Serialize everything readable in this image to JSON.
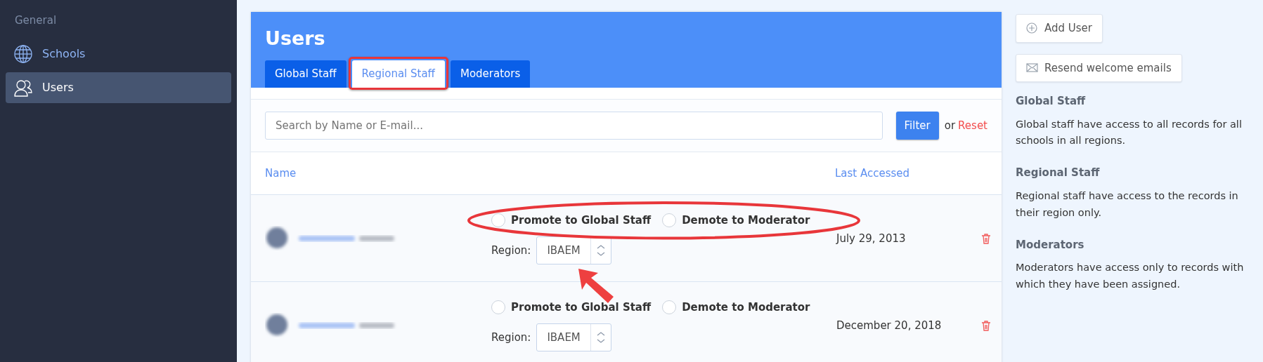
{
  "sidebar": {
    "heading": "General",
    "items": [
      {
        "label": "Schools",
        "selected": false
      },
      {
        "label": "Users",
        "selected": true
      }
    ]
  },
  "panel": {
    "title": "Users",
    "tabs": [
      {
        "label": "Global Staff",
        "selected": false
      },
      {
        "label": "Regional Staff",
        "selected": true
      },
      {
        "label": "Moderators",
        "selected": false
      }
    ],
    "search": {
      "placeholder": "Search by Name or E-mail..."
    },
    "filter_button": "Filter",
    "or_text": "or",
    "reset_link": "Reset",
    "columns": [
      "Name",
      "Last Accessed"
    ],
    "rows": [
      {
        "options": [
          {
            "label": "Promote to Global Staff",
            "selected": false
          },
          {
            "label": "Demote to Moderator",
            "selected": false
          }
        ],
        "region_label": "Region:",
        "region": "IBAEM",
        "last_accessed": "July 29, 2013"
      },
      {
        "options": [
          {
            "label": "Promote to Global Staff",
            "selected": false
          },
          {
            "label": "Demote to Moderator",
            "selected": false
          }
        ],
        "region_label": "Region:",
        "region": "IBAEM",
        "last_accessed": "December 20, 2018"
      }
    ]
  },
  "actions": [
    {
      "label": "Add User"
    },
    {
      "label": "Resend welcome emails"
    }
  ],
  "help": [
    {
      "title": "Global Staff",
      "text": "Global staff have access to all records for all schools in all regions."
    },
    {
      "title": "Regional Staff",
      "text": "Regional staff have access to the records in their region only."
    },
    {
      "title": "Moderators",
      "text": "Moderators have access only to records with which they have been assigned."
    }
  ]
}
